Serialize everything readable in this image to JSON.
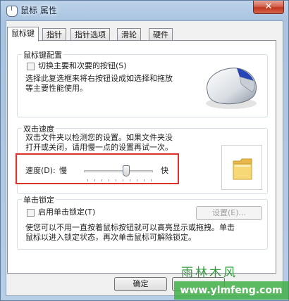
{
  "window": {
    "title": "鼠标 属性",
    "close_label": "✕"
  },
  "tabs": [
    {
      "label": "鼠标键"
    },
    {
      "label": "指针"
    },
    {
      "label": "指针选项"
    },
    {
      "label": "滑轮"
    },
    {
      "label": "硬件"
    }
  ],
  "buttons_config": {
    "group_title": "鼠标键配置",
    "checkbox_label": "切换主要和次要的按钮(S)",
    "description_line1": "选择此复选框来将右按钮设成如选择和拖放",
    "description_line2": "等主要性能使用。"
  },
  "double_click": {
    "group_title": "双击速度",
    "description_line1": "双击文件夹以检测您的设置。如果文件夹没",
    "description_line2": "打开或关闭，请用慢一点的设置再试一次。",
    "speed_label": "速度(D):",
    "slow_label": "慢",
    "fast_label": "快",
    "slider_value": 0.6
  },
  "click_lock": {
    "group_title": "单击锁定",
    "checkbox_label": "启用单击锁定(T)",
    "settings_button": "设置(E)...",
    "description_line1": "使您可以不用一直按着鼠标按钮就可以高亮显示或拖拽。单击",
    "description_line2": "鼠标以进入锁定状态，再次单击鼠标可解除锁定。"
  },
  "footer": {
    "ok_button": "确定"
  },
  "watermark": {
    "title": "雨林木风",
    "url": "www.ylmfeng.com"
  },
  "colors": {
    "highlight": "#e0302a",
    "folder": "#f1cf63"
  }
}
